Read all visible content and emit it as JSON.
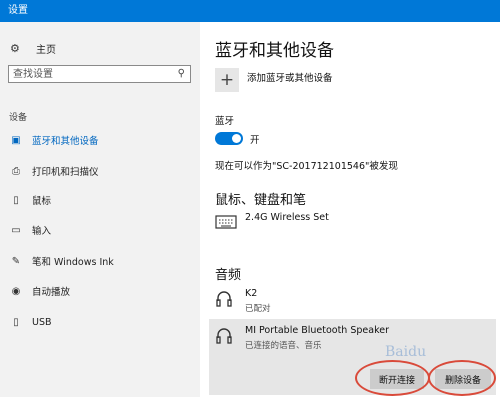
{
  "window": {
    "title": "设置"
  },
  "sidebar": {
    "home_label": "主页",
    "search_placeholder": "查找设置",
    "section_label": "设备",
    "items": [
      {
        "label": "蓝牙和其他设备",
        "icon": "bluetooth-devices-icon",
        "active": true
      },
      {
        "label": "打印机和扫描仪",
        "icon": "printer-icon"
      },
      {
        "label": "鼠标",
        "icon": "mouse-icon"
      },
      {
        "label": "输入",
        "icon": "keyboard-icon"
      },
      {
        "label": "笔和 Windows Ink",
        "icon": "pen-icon"
      },
      {
        "label": "自动播放",
        "icon": "autoplay-icon"
      },
      {
        "label": "USB",
        "icon": "usb-icon"
      }
    ]
  },
  "main": {
    "title": "蓝牙和其他设备",
    "add_device_label": "添加蓝牙或其他设备",
    "bluetooth": {
      "label": "蓝牙",
      "toggle_state": "开",
      "discoverable_text": "现在可以作为\"SC-201712101546\"被发现"
    },
    "mouse_keyboard_section": {
      "title": "鼠标、键盘和笔",
      "devices": [
        {
          "name": "2.4G Wireless Set",
          "icon": "keyboard-icon"
        }
      ]
    },
    "audio_section": {
      "title": "音频",
      "devices": [
        {
          "name": "K2",
          "status": "已配对",
          "icon": "headphones-icon"
        },
        {
          "name": "MI Portable Bluetooth Speaker",
          "status": "已连接的语音、音乐",
          "icon": "headphones-icon"
        }
      ],
      "disconnect_label": "断开连接",
      "remove_label": "删除设备"
    }
  },
  "colors": {
    "accent": "#0078d7",
    "annotation": "#d94a3a"
  },
  "watermark_text": "Baidu"
}
